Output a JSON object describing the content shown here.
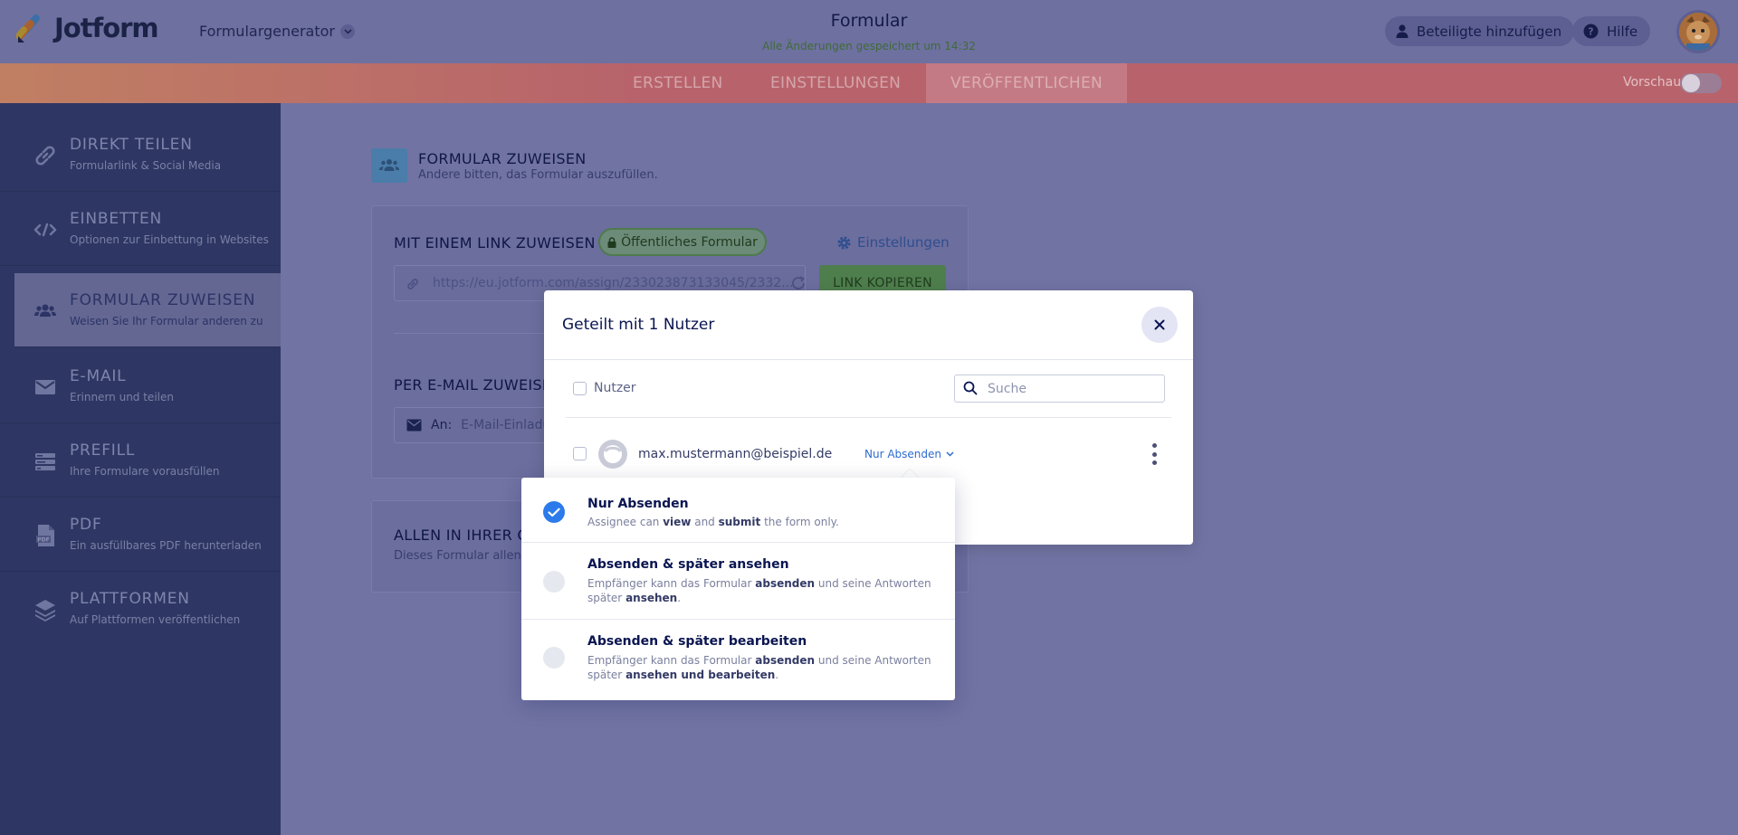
{
  "header": {
    "logo_text": "Jotform",
    "generator_label": "Formulargenerator",
    "form_title": "Formular",
    "saved_status": "Alle Änderungen gespeichert um 14:32",
    "add_participants": "Beteiligte hinzufügen",
    "help": "Hilfe"
  },
  "nav": {
    "tabs": [
      "ERSTELLEN",
      "EINSTELLUNGEN",
      "VERÖFFENTLICHEN"
    ],
    "active_tab": "VERÖFFENTLICHEN",
    "preview_label": "Vorschau"
  },
  "sidebar": {
    "items": [
      {
        "title": "DIREKT TEILEN",
        "subtitle": "Formularlink & Social Media",
        "icon": "link-icon"
      },
      {
        "title": "EINBETTEN",
        "subtitle": "Optionen zur Einbettung in Websites",
        "icon": "code-icon"
      },
      {
        "title": "FORMULAR ZUWEISEN",
        "subtitle": "Weisen Sie Ihr Formular anderen zu",
        "icon": "users-icon"
      },
      {
        "title": "E-MAIL",
        "subtitle": "Erinnern und teilen",
        "icon": "envelope-icon"
      },
      {
        "title": "PREFILL",
        "subtitle": "Ihre Formulare vorausfüllen",
        "icon": "prefill-icon"
      },
      {
        "title": "PDF",
        "subtitle": "Ein ausfüllbares PDF herunterladen",
        "icon": "pdf-icon"
      },
      {
        "title": "PLATTFORMEN",
        "subtitle": "Auf Plattformen veröffentlichen",
        "icon": "layers-icon"
      }
    ],
    "active_index": 2
  },
  "main": {
    "section_title": "FORMULAR ZUWEISEN",
    "section_subtitle": "Andere bitten, das Formular auszufüllen.",
    "link_assign_label": "MIT EINEM LINK ZUWEISEN",
    "public_badge": "Öffentliches Formular",
    "settings_label": "Einstellungen",
    "link_url": "https://eu.jotform.com/assign/233023873133045/2332...",
    "copy_button": "LINK KOPIEREN",
    "email_assign_label": "PER E-MAIL ZUWEISE",
    "email_to_label": "An:",
    "email_placeholder": "E-Mail-Einladu",
    "org_label": "ALLEN IN IHRER O",
    "org_desc": "Dieses Formular allen I"
  },
  "modal": {
    "title": "Geteilt mit 1 Nutzer",
    "users_header": "Nutzer",
    "search_placeholder": "Suche",
    "user_email": "max.mustermann@beispiel.de",
    "user_role": "Nur Absenden"
  },
  "dropdown": {
    "options": [
      {
        "title": "Nur Absenden",
        "selected": true,
        "desc": [
          {
            "t": "Assignee can ",
            "b": false
          },
          {
            "t": "view",
            "b": true
          },
          {
            "t": " and ",
            "b": false
          },
          {
            "t": "submit",
            "b": true
          },
          {
            "t": " the form only.",
            "b": false
          }
        ]
      },
      {
        "title": "Absenden & später ansehen",
        "selected": false,
        "desc": [
          {
            "t": "Empfänger kann das Formular ",
            "b": false
          },
          {
            "t": "absenden",
            "b": true
          },
          {
            "t": " und seine Antworten später ",
            "b": false
          },
          {
            "t": "ansehen",
            "b": true
          },
          {
            "t": ".",
            "b": false
          }
        ]
      },
      {
        "title": "Absenden & später bearbeiten",
        "selected": false,
        "desc": [
          {
            "t": "Empfänger kann das Formular ",
            "b": false
          },
          {
            "t": "absenden",
            "b": true
          },
          {
            "t": " und seine Antworten später ",
            "b": false
          },
          {
            "t": "ansehen und bearbeiten",
            "b": true
          },
          {
            "t": ".",
            "b": false
          }
        ]
      }
    ]
  },
  "colors": {
    "overlay": "#7173a3",
    "sidebar": "#2e3763",
    "accent_blue": "#2c7bea",
    "nav_bar": "#b8636b"
  }
}
